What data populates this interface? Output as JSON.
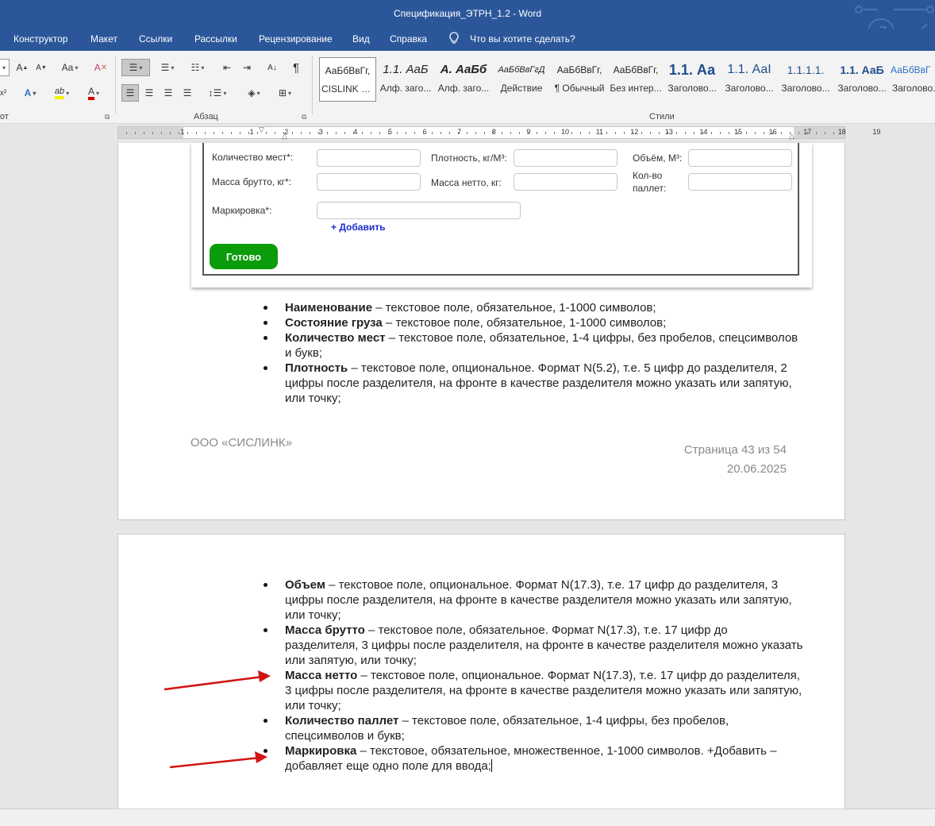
{
  "window": {
    "title": "Спецификация_ЭТРН_1.2  -  Word"
  },
  "ribbon_tabs": [
    "Конструктор",
    "Макет",
    "Ссылки",
    "Рассылки",
    "Рецензирование",
    "Вид",
    "Справка"
  ],
  "tell_me": "Что вы хотите сделать?",
  "ribbon": {
    "font_group_label": "от",
    "paragraph_group_label": "Абзац",
    "styles_group_label": "Стили",
    "styles": [
      {
        "preview": "АаБбВвГг,",
        "label": "CISLINK о..."
      },
      {
        "preview": "1.1.  АаБ",
        "label": "Алф. заго..."
      },
      {
        "preview": "А.  АаБб",
        "label": "Алф. заго..."
      },
      {
        "preview": "АаБбВвГгД",
        "label": "Действие"
      },
      {
        "preview": "АаБбВвГг,",
        "label": "¶ Обычный"
      },
      {
        "preview": "АаБбВвГг,",
        "label": "Без интер..."
      },
      {
        "preview": "1.1.  Аа",
        "label": "Заголово..."
      },
      {
        "preview": "1.1.  АаI",
        "label": "Заголово..."
      },
      {
        "preview": "1.1.1.1.",
        "label": "Заголово..."
      },
      {
        "preview": "1.1.  АаБ",
        "label": "Заголово..."
      },
      {
        "preview": "АаБбВвГ",
        "label": "Заголово..."
      }
    ]
  },
  "ruler": {
    "numbers": [
      "1",
      "1",
      "2",
      "3",
      "4",
      "5",
      "6",
      "7",
      "8",
      "9",
      "10",
      "11",
      "12",
      "13",
      "14",
      "15",
      "16",
      "17",
      "18",
      "19"
    ]
  },
  "form": {
    "places_label": "Количество мест*:",
    "density_label": "Плотность, кг/М³:",
    "volume_label": "Объём, М³:",
    "gross_label": "Масса брутто, кг*:",
    "net_label": "Масса нетто, кг:",
    "pallets_label_1": "Кол-во",
    "pallets_label_2": "паллет:",
    "marking_label": "Маркировка*:",
    "add_link": "+ Добавить",
    "done_button": "Готово"
  },
  "page1_items": [
    {
      "term": "Наименование",
      "text": " – текстовое поле, обязательное, 1-1000 символов;"
    },
    {
      "term": "Состояние груза",
      "text": " – текстовое поле, обязательное, 1-1000 символов;"
    },
    {
      "term": "Количество мест",
      "text": " – текстовое поле, обязательное, 1-4 цифры, без пробелов, спецсимволов и букв;"
    },
    {
      "term": "Плотность",
      "text": " – текстовое поле, опциональное. Формат N(5.2), т.е. 5 цифр до разделителя, 2 цифры после разделителя, на фронте в качестве разделителя можно указать или запятую, или точку;"
    }
  ],
  "footer": {
    "company": "ООО «СИСЛИНК»",
    "page": "Страница 43 из 54",
    "date": "20.06.2025"
  },
  "page2_items": [
    {
      "term": "Объем",
      "text": " – текстовое поле, опциональное. Формат N(17.3), т.е. 17 цифр до разделителя, 3 цифры после разделителя, на фронте в качестве разделителя можно указать или запятую, или точку;"
    },
    {
      "term": "Масса брутто",
      "text": " – текстовое поле, обязательное. Формат N(17.3), т.е. 17 цифр до разделителя, 3 цифры после разделителя, на фронте в качестве разделителя можно указать или запятую, или точку;"
    },
    {
      "term": "Масса нетто",
      "text": " – текстовое поле, опциональное. Формат N(17.3), т.е. 17 цифр до разделителя, 3 цифры после разделителя, на фронте в качестве разделителя можно указать или запятую, или точку;"
    },
    {
      "term": "Количество паллет",
      "text": " – текстовое поле, обязательное, 1-4 цифры, без пробелов, спецсимволов и букв;"
    },
    {
      "term": "Маркировка",
      "text": " – текстовое, обязательное, множественное, 1-1000 символов. +Добавить – добавляет еще одно поле для ввода;"
    }
  ],
  "colors": {
    "title_bar": "#2b579a",
    "annotation_arrow": "#d21414",
    "done_button": "#0b9c0b",
    "add_link": "#1a2bcc"
  }
}
